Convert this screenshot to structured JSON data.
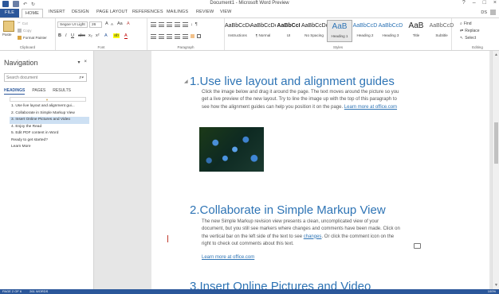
{
  "window": {
    "title": "Document1 - Microsoft Word Preview",
    "controls": [
      "?",
      "–",
      "□",
      "×"
    ]
  },
  "tabs": [
    "FILE",
    "HOME",
    "INSERT",
    "DESIGN",
    "PAGE LAYOUT",
    "REFERENCES",
    "MAILINGS",
    "REVIEW",
    "VIEW"
  ],
  "active_tab": "HOME",
  "user": "DS",
  "ribbon": {
    "clipboard": {
      "paste": "Paste",
      "cut": "Cut",
      "copy": "Copy",
      "format_painter": "Format Painter",
      "label": "Clipboard"
    },
    "font": {
      "name": "Segoe UI Light",
      "size": "26",
      "label": "Font"
    },
    "paragraph": {
      "label": "Paragraph"
    },
    "styles": {
      "label": "Styles",
      "items": [
        {
          "sample": "AaBbCcDc",
          "name": "Instructions"
        },
        {
          "sample": "AaBbCcDc",
          "name": "¶ Normal"
        },
        {
          "sample": "AaBbCcI",
          "name": "UI"
        },
        {
          "sample": "AaBbCcDc",
          "name": "No Spacing"
        },
        {
          "sample": "AaB",
          "name": "Heading 1"
        },
        {
          "sample": "AaBbCcD",
          "name": "Heading 2"
        },
        {
          "sample": "AaBbCcD",
          "name": "Heading 3"
        },
        {
          "sample": "AaB",
          "name": "Title"
        },
        {
          "sample": "AaBbCcD",
          "name": "Subtitle"
        }
      ],
      "selected": "Heading 1"
    },
    "editing": {
      "find": "Find",
      "replace": "Replace",
      "select": "Select",
      "label": "Editing"
    }
  },
  "navigation": {
    "title": "Navigation",
    "search_placeholder": "Search document",
    "tabs": [
      "HEADINGS",
      "PAGES",
      "RESULTS"
    ],
    "active_tab": "HEADINGS",
    "items": [
      "1. Use live layout and alignment gui...",
      "2. Collaborate in Simple Markup View",
      "3. Insert Online Pictures and Video",
      "4. Enjoy the Read",
      "5. Edit PDF content in Word",
      "Ready to get started?",
      "Learn More"
    ],
    "selected_index": 2
  },
  "document": {
    "sections": [
      {
        "num": "1.",
        "heading": "Use live layout and alignment guides",
        "body": "Click the image below and drag it around the page. The text moves around the picture so you get a live preview of the new layout. Try to line the image up with the top of this paragraph to see how the alignment guides can help you position it on the page.",
        "link": "Learn more at office.com"
      },
      {
        "num": "2.",
        "heading": "Collaborate in Simple Markup View",
        "body_before": "The new Simple Markup revision view presents a clean, uncomplicated view of your document, but you still see markers where changes and comments have been made. Click on the vertical bar on the left side of the text to see",
        "body_link": "changes",
        "body_after": ". Or click the comment icon on the right to check out comments about this text.",
        "link": "Learn more at office.com"
      },
      {
        "num": "3.",
        "heading": "Insert Online Pictures and Video"
      }
    ]
  },
  "status": {
    "page": "PAGE 2 OF 6",
    "words": "261 WORDS",
    "zoom": "100%"
  }
}
